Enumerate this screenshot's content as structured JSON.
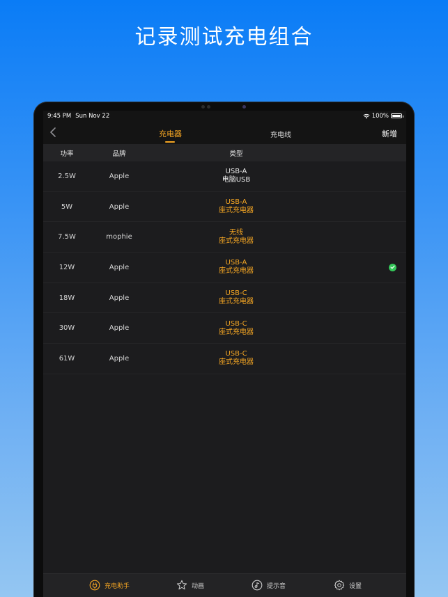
{
  "hero": {
    "title": "记录测试充电组合"
  },
  "status": {
    "time": "9:45 PM",
    "date": "Sun Nov 22",
    "battery": "100%"
  },
  "nav": {
    "tab_chargers": "充电器",
    "tab_cables": "充电线",
    "add_label": "新增"
  },
  "table": {
    "headers": {
      "power": "功率",
      "brand": "品牌",
      "type": "类型"
    },
    "rows": [
      {
        "power": "2.5W",
        "brand": "Apple",
        "type1": "USB-A",
        "type2": "电脑USB"
      },
      {
        "power": "5W",
        "brand": "Apple",
        "type1": "USB-A",
        "type2": "座式充电器"
      },
      {
        "power": "7.5W",
        "brand": "mophie",
        "type1": "无线",
        "type2": "座式充电器"
      },
      {
        "power": "12W",
        "brand": "Apple",
        "type1": "USB-A",
        "type2": "座式充电器",
        "selected": true
      },
      {
        "power": "18W",
        "brand": "Apple",
        "type1": "USB-C",
        "type2": "座式充电器"
      },
      {
        "power": "30W",
        "brand": "Apple",
        "type1": "USB-C",
        "type2": "座式充电器"
      },
      {
        "power": "61W",
        "brand": "Apple",
        "type1": "USB-C",
        "type2": "座式充电器"
      }
    ]
  },
  "tabbar": {
    "items": [
      {
        "label": "充电助手",
        "icon": "plug-icon"
      },
      {
        "label": "动画",
        "icon": "star-icon"
      },
      {
        "label": "提示音",
        "icon": "music-disc-icon"
      },
      {
        "label": "设置",
        "icon": "gear-icon"
      }
    ]
  },
  "colors": {
    "accent": "#f5a623",
    "check": "#34c759",
    "screen_bg": "#1c1c1e"
  }
}
